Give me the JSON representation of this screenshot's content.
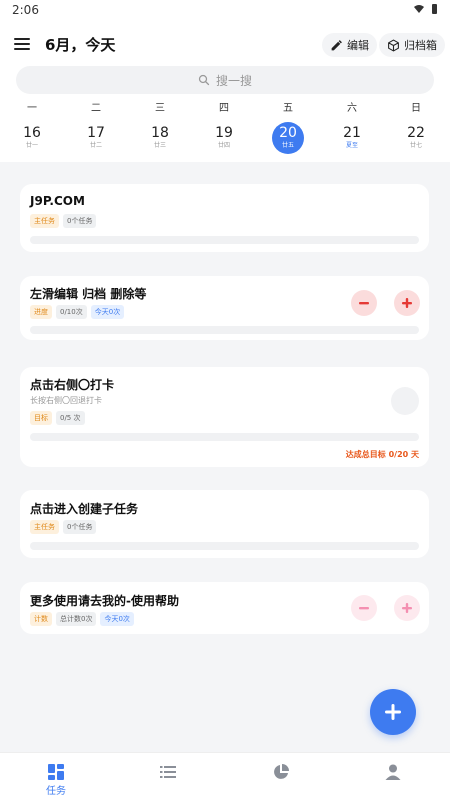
{
  "status_bar": {
    "time": "2:06"
  },
  "header": {
    "title": "6月，今天",
    "edit_label": "编辑",
    "archive_label": "归档箱"
  },
  "search": {
    "placeholder": "搜一搜"
  },
  "week": [
    {
      "weekday": "一",
      "day": "16",
      "lunar": "廿一",
      "active": false
    },
    {
      "weekday": "二",
      "day": "17",
      "lunar": "廿二",
      "active": false
    },
    {
      "weekday": "三",
      "day": "18",
      "lunar": "廿三",
      "active": false
    },
    {
      "weekday": "四",
      "day": "19",
      "lunar": "廿四",
      "active": false
    },
    {
      "weekday": "五",
      "day": "20",
      "lunar": "廿五",
      "active": true
    },
    {
      "weekday": "六",
      "day": "21",
      "lunar": "夏至",
      "active": false
    },
    {
      "weekday": "日",
      "day": "22",
      "lunar": "廿七",
      "active": false
    }
  ],
  "cards": [
    {
      "title": "J9P.COM",
      "tags": [
        "主任务",
        "0个任务"
      ]
    },
    {
      "title": "左滑编辑 归档 删除等",
      "tags": [
        "进度",
        "0/10次",
        "今天0次"
      ]
    },
    {
      "title": "点击右侧〇打卡",
      "subtitle": "长按右侧〇回退打卡",
      "tags": [
        "目标",
        "0/5 次"
      ],
      "status": "达成总目标 0/20 天"
    },
    {
      "title": "点击进入创建子任务",
      "tags": [
        "主任务",
        "0个任务"
      ]
    },
    {
      "title": "更多使用请去我的-使用帮助",
      "tags": [
        "计数",
        "总计数0次",
        "今天0次"
      ]
    }
  ],
  "bottom_nav": {
    "tasks_label": "任务"
  },
  "icons": [
    "menu-icon",
    "pencil-icon",
    "box-icon",
    "search-icon",
    "minus-icon",
    "plus-icon",
    "grid-icon",
    "list-icon",
    "pie-chart-icon",
    "person-icon",
    "wifi-icon",
    "battery-icon"
  ],
  "colors": {
    "accent": "#3e7bf0",
    "red": "#e53935",
    "orange": "#e8581c"
  }
}
